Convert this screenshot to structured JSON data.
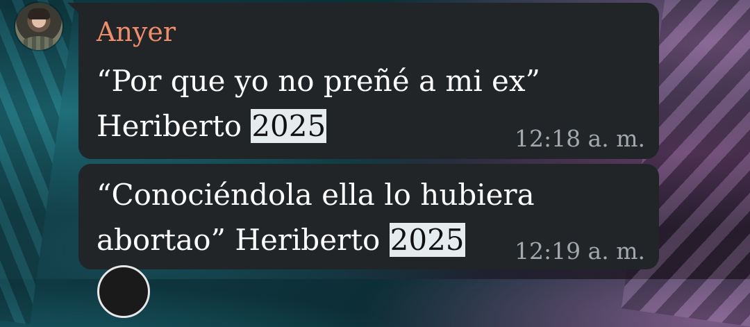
{
  "chat": {
    "sender": "Anyer",
    "messages": [
      {
        "line1": "“Por que yo no preñé a mi ex”",
        "line2_prefix": "Heriberto ",
        "highlight": "2025",
        "time": "12:18 a. m."
      },
      {
        "line1": "“Conociéndola ella lo hubiera",
        "line2_prefix": "abortao” Heriberto ",
        "highlight": "2025",
        "time": "12:19 a. m."
      }
    ]
  },
  "colors": {
    "bubble": "#212528",
    "sender_name": "#f08d6b",
    "timestamp": "#a3a9ae",
    "highlight": "#e6ecee"
  }
}
